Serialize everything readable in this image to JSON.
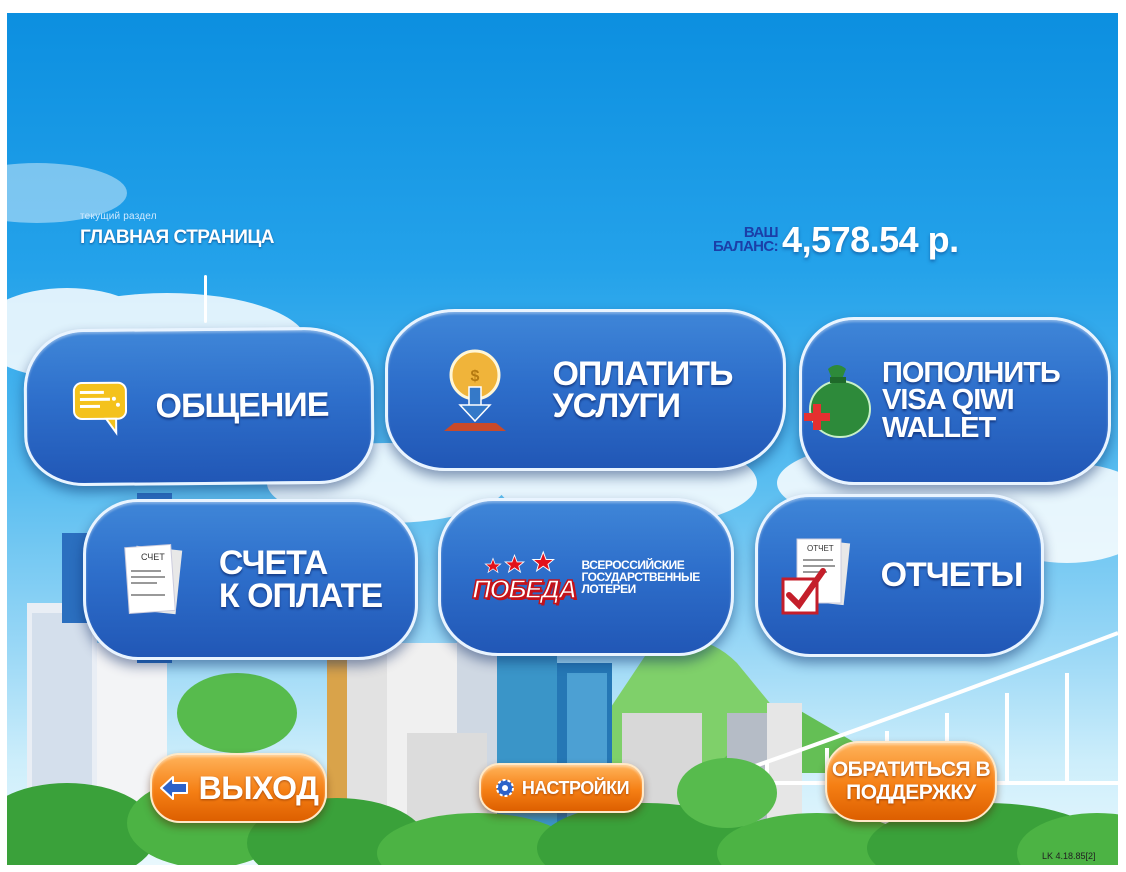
{
  "header": {
    "section_caption": "текущий раздел",
    "section_title": "ГЛАВНАЯ СТРАНИЦА",
    "balance_label_line1": "ВАШ",
    "balance_label_line2": "БАЛАНС:",
    "balance_value": "4,578.54 р."
  },
  "tiles": {
    "chat": {
      "label": "ОБЩЕНИЕ",
      "icon": "chat-bubble-icon"
    },
    "pay": {
      "line1": "ОПЛАТИТЬ",
      "line2": "УСЛУГИ",
      "icon": "pay-coin-icon"
    },
    "topup": {
      "line1": "ПОПОЛНИТЬ",
      "line2": "VISA QIWI WALLET",
      "icon": "money-bag-icon"
    },
    "bills": {
      "line1": "СЧЕТА",
      "line2": "К ОПЛАТЕ",
      "icon": "invoice-icon",
      "icon_text": "СЧЕТ"
    },
    "lottery": {
      "brand": "ПОБЕДА",
      "line1": "ВСЕРОССИЙСКИЕ",
      "line2": "ГОСУДАРСТВЕННЫЕ",
      "line3": "ЛОТЕРЕИ"
    },
    "reports": {
      "label": "ОТЧЕТЫ",
      "icon": "report-icon",
      "icon_text": "ОТЧЕТ"
    }
  },
  "footer": {
    "exit_label": "ВЫХОД",
    "settings_label": "НАСТРОЙКИ",
    "support_line1": "ОБРАТИТЬСЯ В",
    "support_line2": "ПОДДЕРЖКУ",
    "version": "LK 4.18.85[2]"
  },
  "colors": {
    "tile_blue": "#2e6fcb",
    "button_orange": "#f57f14",
    "balance_label": "#1b3fa8",
    "lottery_red": "#c3121b"
  }
}
